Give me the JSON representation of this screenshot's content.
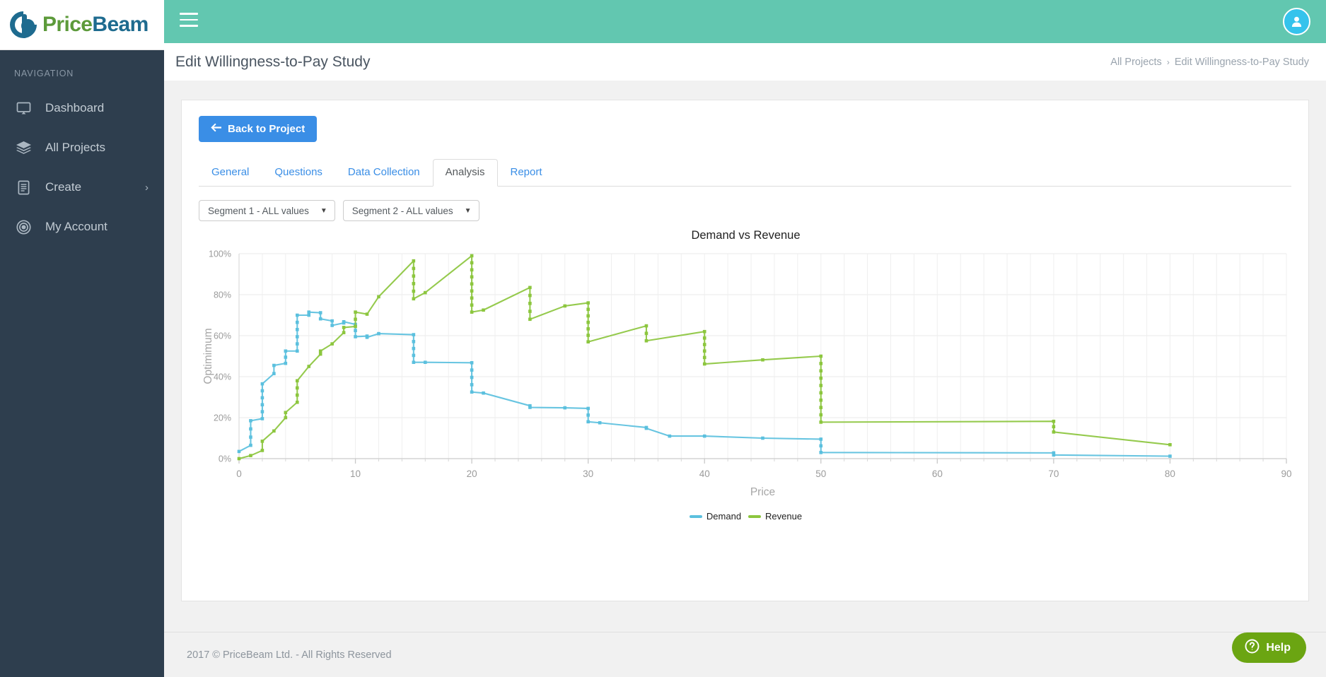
{
  "brand": {
    "logo_text_1": "Price",
    "logo_text_2": "Beam",
    "logo_icon": "pricebeam-b-logo",
    "color_blue": "#1e6b8f",
    "color_green": "#5c9a3a"
  },
  "sidebar": {
    "nav_heading": "NAVIGATION",
    "items": [
      {
        "label": "Dashboard",
        "icon": "monitor-icon",
        "has_caret": false
      },
      {
        "label": "All Projects",
        "icon": "layers-icon",
        "has_caret": false
      },
      {
        "label": "Create",
        "icon": "document-icon",
        "has_caret": true,
        "caret": "›"
      },
      {
        "label": "My Account",
        "icon": "target-icon",
        "has_caret": false
      }
    ]
  },
  "topbar": {
    "menu_icon": "hamburger-icon",
    "avatar_icon": "user-avatar-icon",
    "background": "#62c7b0"
  },
  "header": {
    "title": "Edit Willingness-to-Pay Study",
    "breadcrumb": {
      "root": "All Projects",
      "separator": "›",
      "current": "Edit Willingness-to-Pay Study"
    }
  },
  "toolbar": {
    "back_label": "Back to Project",
    "back_icon": "arrow-left-icon",
    "back_color": "#3a8ee6"
  },
  "tabs": [
    {
      "label": "General",
      "active": false
    },
    {
      "label": "Questions",
      "active": false
    },
    {
      "label": "Data Collection",
      "active": false
    },
    {
      "label": "Analysis",
      "active": true
    },
    {
      "label": "Report",
      "active": false
    }
  ],
  "filters": [
    {
      "label": "Segment 1 - ALL values",
      "caret": "▼"
    },
    {
      "label": "Segment 2 - ALL values",
      "caret": "▼"
    }
  ],
  "footer": {
    "copyright": "2017 © PriceBeam Ltd. - All Rights Reserved"
  },
  "help": {
    "label": "Help",
    "icon": "question-circle-icon",
    "color": "#6ba512"
  },
  "chart_data": {
    "type": "line",
    "title": "Demand vs Revenue",
    "xlabel": "Price",
    "ylabel": "Optimimum",
    "xlim": [
      0,
      90
    ],
    "ylim": [
      0,
      1.0
    ],
    "xticks": [
      0,
      10,
      20,
      30,
      40,
      50,
      60,
      70,
      80,
      90
    ],
    "xticklabels": [
      "0",
      "10",
      "20",
      "30",
      "40",
      "50",
      "60",
      "70",
      "80",
      "90"
    ],
    "yticks": [
      0,
      0.2,
      0.4,
      0.6,
      0.8,
      1.0
    ],
    "yticklabels": [
      "0%",
      "20%",
      "40%",
      "60%",
      "80%",
      "100%"
    ],
    "grid": true,
    "legend_position": "bottom",
    "series": [
      {
        "name": "Demand",
        "color": "#5bc0de",
        "step": true,
        "points": [
          [
            0.0,
            0.035
          ],
          [
            1.0,
            0.065
          ],
          [
            1.0,
            0.185
          ],
          [
            2.0,
            0.195
          ],
          [
            2.0,
            0.365
          ],
          [
            3.0,
            0.415
          ],
          [
            3.0,
            0.455
          ],
          [
            4.0,
            0.465
          ],
          [
            4.0,
            0.525
          ],
          [
            5.0,
            0.525
          ],
          [
            5.0,
            0.7
          ],
          [
            6.0,
            0.7
          ],
          [
            6.0,
            0.715
          ],
          [
            7.0,
            0.712
          ],
          [
            7.0,
            0.682
          ],
          [
            8.0,
            0.672
          ],
          [
            8.0,
            0.65
          ],
          [
            9.0,
            0.662
          ],
          [
            9.0,
            0.668
          ],
          [
            10.0,
            0.655
          ],
          [
            10.0,
            0.595
          ],
          [
            11.0,
            0.598
          ],
          [
            11.0,
            0.592
          ],
          [
            12.0,
            0.61
          ],
          [
            15.0,
            0.605
          ],
          [
            15.0,
            0.47
          ],
          [
            16.0,
            0.47
          ],
          [
            20.0,
            0.468
          ],
          [
            20.0,
            0.325
          ],
          [
            21.0,
            0.32
          ],
          [
            25.0,
            0.258
          ],
          [
            25.0,
            0.25
          ],
          [
            28.0,
            0.248
          ],
          [
            30.0,
            0.245
          ],
          [
            30.0,
            0.18
          ],
          [
            31.0,
            0.175
          ],
          [
            35.0,
            0.152
          ],
          [
            35.0,
            0.148
          ],
          [
            37.0,
            0.11
          ],
          [
            40.0,
            0.11
          ],
          [
            45.0,
            0.1
          ],
          [
            50.0,
            0.095
          ],
          [
            50.0,
            0.03
          ],
          [
            70.0,
            0.028
          ],
          [
            70.0,
            0.018
          ],
          [
            80.0,
            0.012
          ]
        ]
      },
      {
        "name": "Revenue",
        "color": "#8cc63e",
        "step": true,
        "points": [
          [
            0.0,
            0.0
          ],
          [
            1.0,
            0.015
          ],
          [
            2.0,
            0.04
          ],
          [
            2.0,
            0.085
          ],
          [
            3.0,
            0.135
          ],
          [
            4.0,
            0.2
          ],
          [
            4.0,
            0.225
          ],
          [
            5.0,
            0.275
          ],
          [
            5.0,
            0.38
          ],
          [
            6.0,
            0.45
          ],
          [
            7.0,
            0.51
          ],
          [
            7.0,
            0.525
          ],
          [
            8.0,
            0.56
          ],
          [
            9.0,
            0.615
          ],
          [
            9.0,
            0.64
          ],
          [
            10.0,
            0.645
          ],
          [
            10.0,
            0.715
          ],
          [
            11.0,
            0.705
          ],
          [
            12.0,
            0.79
          ],
          [
            15.0,
            0.965
          ],
          [
            15.0,
            0.78
          ],
          [
            16.0,
            0.81
          ],
          [
            20.0,
            0.99
          ],
          [
            20.0,
            0.715
          ],
          [
            21.0,
            0.725
          ],
          [
            25.0,
            0.835
          ],
          [
            25.0,
            0.68
          ],
          [
            28.0,
            0.745
          ],
          [
            30.0,
            0.76
          ],
          [
            30.0,
            0.57
          ],
          [
            35.0,
            0.648
          ],
          [
            35.0,
            0.575
          ],
          [
            40.0,
            0.62
          ],
          [
            40.0,
            0.462
          ],
          [
            45.0,
            0.482
          ],
          [
            50.0,
            0.5
          ],
          [
            50.0,
            0.178
          ],
          [
            70.0,
            0.182
          ],
          [
            70.0,
            0.13
          ],
          [
            80.0,
            0.068
          ]
        ]
      }
    ]
  }
}
